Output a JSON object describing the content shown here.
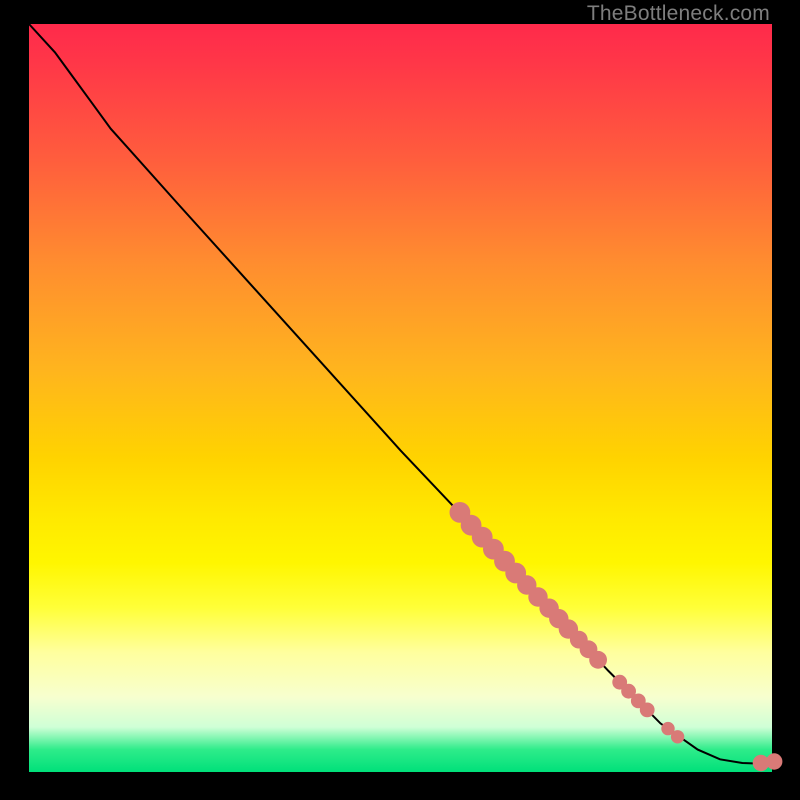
{
  "watermark": "TheBottleneck.com",
  "colors": {
    "bg_black": "#000000",
    "watermark": "#7e7e7e",
    "line": "#000000",
    "point": "#d97a77",
    "gradient_css": "linear-gradient(to bottom, #ff2a4b 0%, #ff3648 5%, #ff5d3d 18%, #ff8d2f 32%, #ffb41e 46%, #ffd300 58%, #ffe900 66%, #fff600 72%, #ffff38 78%, #ffff9e 84%, #f7ffcf 90%, #cfffd6 94%, #2eec8a 97%, #00e07a 100%)"
  },
  "chart_data": {
    "type": "line",
    "title": "",
    "xlabel": "",
    "ylabel": "",
    "xlim": [
      0,
      100
    ],
    "ylim": [
      0,
      100
    ],
    "note": "Curve traced from pixel coordinates inside the 743×748 plot box; x,y are fractions 0–100 of that box. y increases downward (screen space).",
    "series": [
      {
        "name": "curve",
        "kind": "line",
        "points": [
          {
            "x": 0.0,
            "y": 0.0
          },
          {
            "x": 3.5,
            "y": 3.8
          },
          {
            "x": 6.0,
            "y": 7.2
          },
          {
            "x": 8.5,
            "y": 10.6
          },
          {
            "x": 11.0,
            "y": 14.0
          },
          {
            "x": 20.0,
            "y": 24.0
          },
          {
            "x": 30.0,
            "y": 35.0
          },
          {
            "x": 40.0,
            "y": 46.0
          },
          {
            "x": 50.0,
            "y": 57.0
          },
          {
            "x": 60.0,
            "y": 67.5
          },
          {
            "x": 70.0,
            "y": 78.0
          },
          {
            "x": 78.0,
            "y": 86.5
          },
          {
            "x": 85.0,
            "y": 93.5
          },
          {
            "x": 90.0,
            "y": 97.0
          },
          {
            "x": 93.0,
            "y": 98.3
          },
          {
            "x": 96.0,
            "y": 98.8
          },
          {
            "x": 99.0,
            "y": 98.9
          },
          {
            "x": 100.5,
            "y": 98.6
          }
        ]
      },
      {
        "name": "markers",
        "kind": "scatter",
        "radius_pct": 1.2,
        "points": [
          {
            "x": 58.0,
            "y": 65.3,
            "r": 1.4
          },
          {
            "x": 59.5,
            "y": 67.0,
            "r": 1.4
          },
          {
            "x": 61.0,
            "y": 68.6,
            "r": 1.4
          },
          {
            "x": 62.5,
            "y": 70.2,
            "r": 1.4
          },
          {
            "x": 64.0,
            "y": 71.8,
            "r": 1.4
          },
          {
            "x": 65.5,
            "y": 73.4,
            "r": 1.4
          },
          {
            "x": 67.0,
            "y": 75.0,
            "r": 1.3
          },
          {
            "x": 68.5,
            "y": 76.6,
            "r": 1.3
          },
          {
            "x": 70.0,
            "y": 78.1,
            "r": 1.3
          },
          {
            "x": 71.3,
            "y": 79.5,
            "r": 1.3
          },
          {
            "x": 72.6,
            "y": 80.9,
            "r": 1.3
          },
          {
            "x": 74.0,
            "y": 82.3,
            "r": 1.2
          },
          {
            "x": 75.3,
            "y": 83.6,
            "r": 1.2
          },
          {
            "x": 76.6,
            "y": 85.0,
            "r": 1.2
          },
          {
            "x": 79.5,
            "y": 88.0,
            "r": 1.0
          },
          {
            "x": 80.7,
            "y": 89.2,
            "r": 1.0
          },
          {
            "x": 82.0,
            "y": 90.5,
            "r": 1.0
          },
          {
            "x": 83.2,
            "y": 91.7,
            "r": 1.0
          },
          {
            "x": 86.0,
            "y": 94.2,
            "r": 0.9
          },
          {
            "x": 87.3,
            "y": 95.3,
            "r": 0.9
          },
          {
            "x": 98.5,
            "y": 98.8,
            "r": 1.1
          },
          {
            "x": 100.3,
            "y": 98.6,
            "r": 1.1
          }
        ]
      }
    ]
  }
}
